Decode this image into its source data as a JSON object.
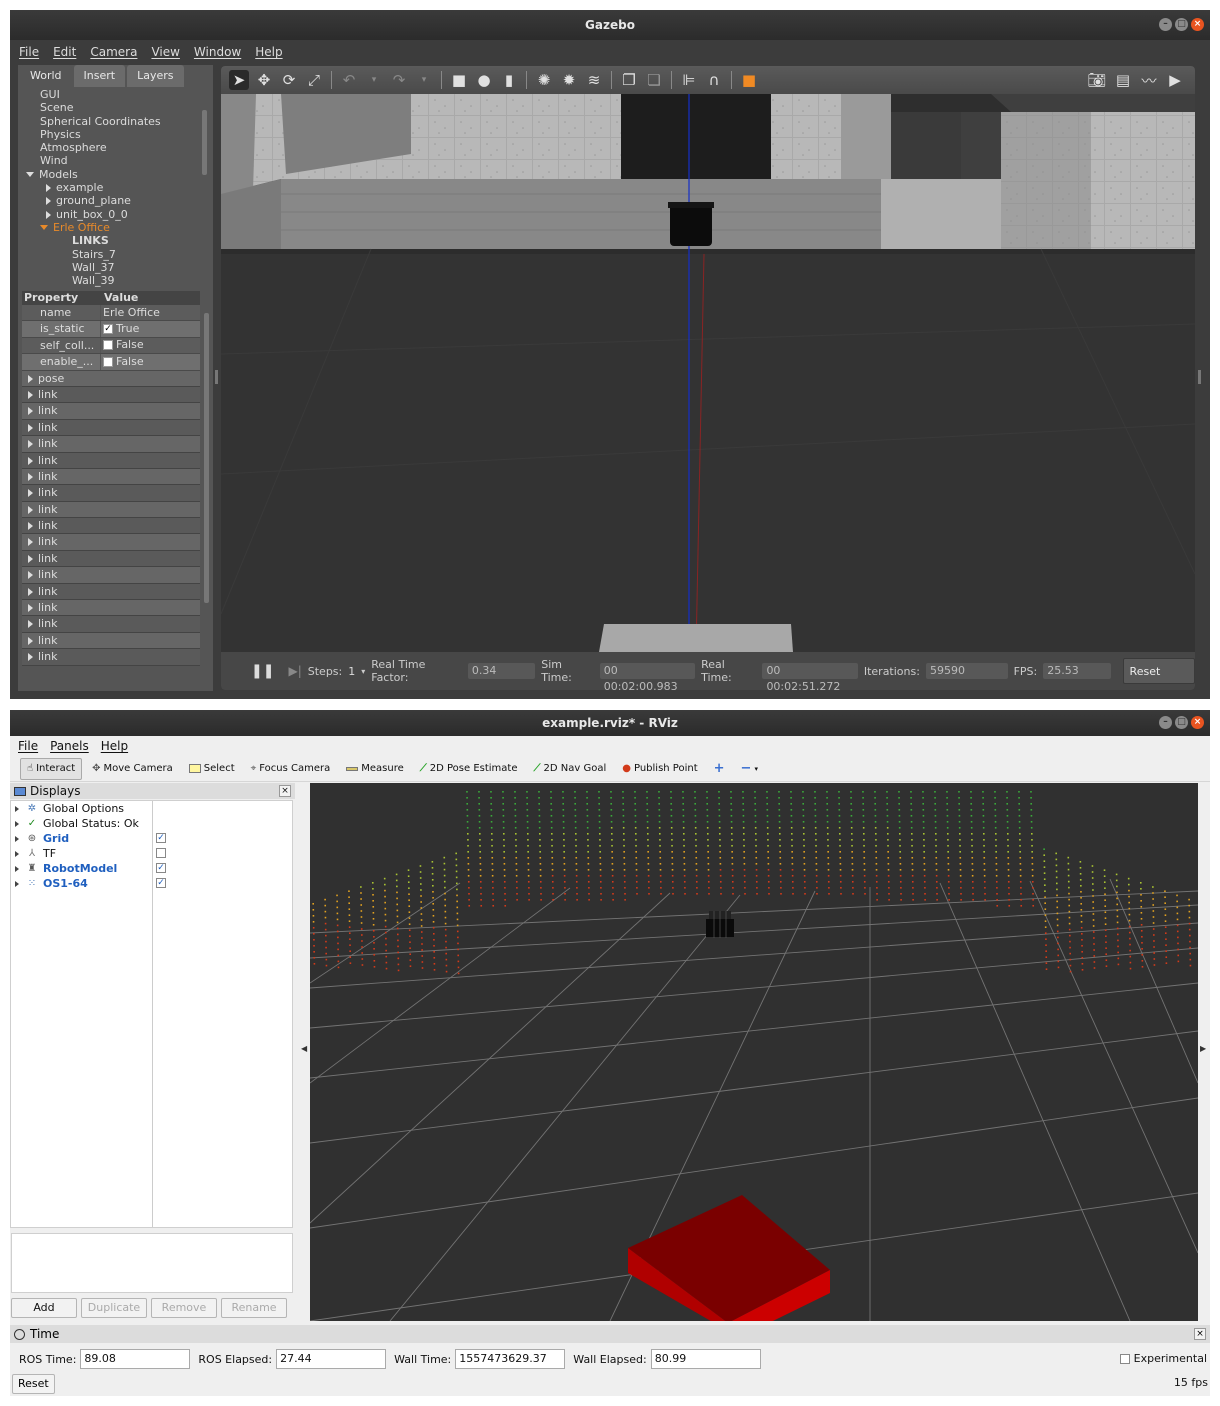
{
  "gazebo": {
    "window_title": "Gazebo",
    "menu": [
      "File",
      "Edit",
      "Camera",
      "View",
      "Window",
      "Help"
    ],
    "tabs": [
      "World",
      "Insert",
      "Layers"
    ],
    "tree": {
      "top_items": [
        "GUI",
        "Scene",
        "Spherical Coordinates",
        "Physics",
        "Atmosphere",
        "Wind"
      ],
      "models_label": "Models",
      "models": [
        "example",
        "ground_plane",
        "unit_box_0_0"
      ],
      "selected_model": "Erle Office",
      "links_header": "LINKS",
      "links": [
        "Stairs_7",
        "Wall_37",
        "Wall_39"
      ]
    },
    "properties": {
      "header_property": "Property",
      "header_value": "Value",
      "rows": [
        {
          "key": "name",
          "value": "Erle Office",
          "checkbox": false
        },
        {
          "key": "is_static",
          "value": "True",
          "checkbox": true,
          "checked": true
        },
        {
          "key": "self_coll...",
          "value": "False",
          "checkbox": true,
          "checked": false
        },
        {
          "key": "enable_...",
          "value": "False",
          "checkbox": true,
          "checked": false
        }
      ],
      "groups": [
        "pose",
        "link",
        "link",
        "link",
        "link",
        "link",
        "link",
        "link",
        "link",
        "link",
        "link",
        "link",
        "link",
        "link",
        "link",
        "link",
        "link",
        "link"
      ]
    },
    "bottom": {
      "steps_label": "Steps:",
      "steps_value": "1",
      "rtf_label": "Real Time Factor:",
      "rtf_value": "0.34",
      "sim_time_label": "Sim Time:",
      "sim_time_value": "00 00:02:00.983",
      "real_time_label": "Real Time:",
      "real_time_value": "00 00:02:51.272",
      "iterations_label": "Iterations:",
      "iterations_value": "59590",
      "fps_label": "FPS:",
      "fps_value": "25.53",
      "reset_label": "Reset Time"
    }
  },
  "rviz": {
    "window_title": "example.rviz* - RViz",
    "menu": [
      "File",
      "Panels",
      "Help"
    ],
    "tools": [
      "Interact",
      "Move Camera",
      "Select",
      "Focus Camera",
      "Measure",
      "2D Pose Estimate",
      "2D Nav Goal",
      "Publish Point"
    ],
    "displays_title": "Displays",
    "displays": [
      {
        "label": "Global Options",
        "icon": "gear-icon",
        "checkbox": false
      },
      {
        "label": "Global Status: Ok",
        "icon": "check-icon",
        "checkbox": false
      },
      {
        "label": "Grid",
        "icon": "grid-icon",
        "checkbox": true,
        "checked": true,
        "highlight": true
      },
      {
        "label": "TF",
        "icon": "tf-icon",
        "checkbox": true,
        "checked": false,
        "highlight": false
      },
      {
        "label": "RobotModel",
        "icon": "robot-icon",
        "checkbox": true,
        "checked": true,
        "highlight": true
      },
      {
        "label": "OS1-64",
        "icon": "pointcloud-icon",
        "checkbox": true,
        "checked": true,
        "highlight": true
      }
    ],
    "panel_buttons": [
      "Add",
      "Duplicate",
      "Remove",
      "Rename"
    ],
    "time": {
      "title": "Time",
      "ros_time_label": "ROS Time:",
      "ros_time": "89.08",
      "ros_elapsed_label": "ROS Elapsed:",
      "ros_elapsed": "27.44",
      "wall_time_label": "Wall Time:",
      "wall_time": "1557473629.37",
      "wall_elapsed_label": "Wall Elapsed:",
      "wall_elapsed": "80.99",
      "experimental_label": "Experimental",
      "reset_label": "Reset",
      "fps": "15 fps"
    }
  }
}
